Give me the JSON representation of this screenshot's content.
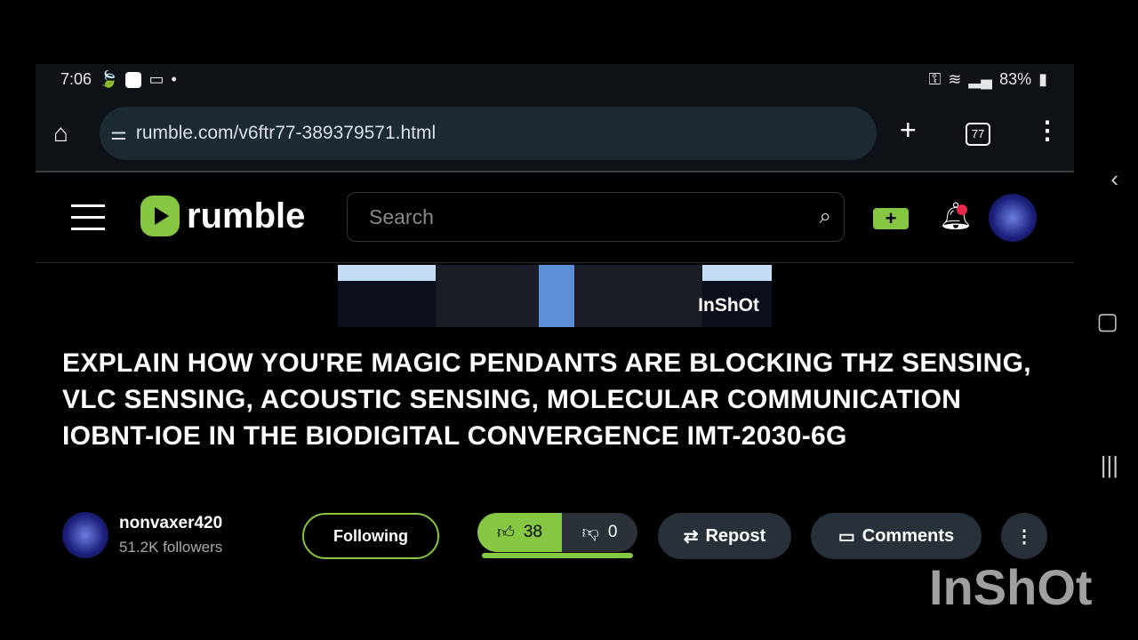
{
  "status": {
    "time": "7:06",
    "battery": "83%"
  },
  "browser": {
    "url": "rumble.com/v6ftr77-389379571.html",
    "tab_count": "77"
  },
  "nav": {
    "brand": "rumble",
    "search_placeholder": "Search",
    "accent": "#85c742",
    "notification_color": "#e8274b"
  },
  "video": {
    "watermark": "InShOt",
    "title": "EXPLAIN HOW YOU'RE MAGIC PENDANTS ARE BLOCKING THZ SENSING, VLC SENSING, ACOUSTIC SENSING, MOLECULAR COMMUNICATION IOBNT-IOE IN THE BIODIGITAL CONVERGENCE IMT-2030-6G"
  },
  "channel": {
    "name": "nonvaxer420",
    "followers": "51.2K followers",
    "follow_label": "Following"
  },
  "actions": {
    "likes": "38",
    "dislikes": "0",
    "repost": "Repost",
    "comments": "Comments",
    "like_ratio": 1.0
  },
  "overlay": {
    "watermark": "InShOt"
  }
}
